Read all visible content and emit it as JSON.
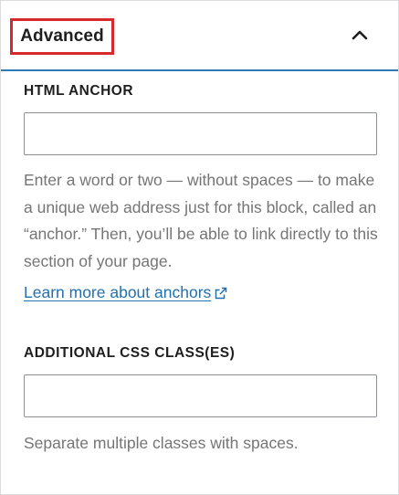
{
  "panel": {
    "title": "Advanced",
    "toggle_icon": "chevron-up-icon"
  },
  "html_anchor": {
    "label": "HTML ANCHOR",
    "value": "",
    "help": "Enter a word or two — without spaces — to make a unique web address just for this block, called an “anchor.” Then, you’ll be able to link directly to this section of your page.",
    "link_label": "Learn more about anchors",
    "link_icon": "external-link-icon"
  },
  "css_classes": {
    "label": "ADDITIONAL CSS CLASS(ES)",
    "value": "",
    "help": "Separate multiple classes with spaces."
  },
  "colors": {
    "accent": "#2c7bb6",
    "highlight_box": "#d7282f",
    "link": "#2271b1",
    "help_text": "#757575"
  }
}
